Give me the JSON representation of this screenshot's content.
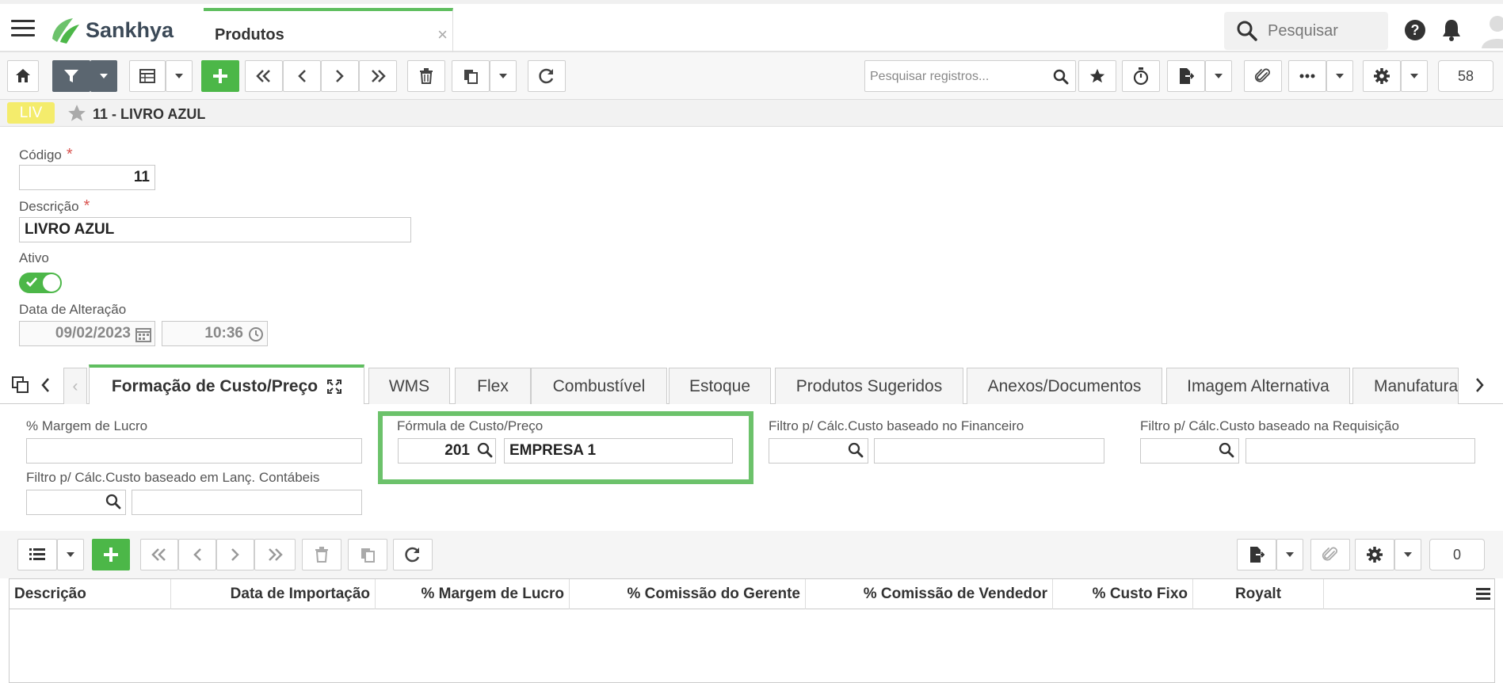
{
  "app": {
    "brand": "Sankhya",
    "tab_title": "Produtos",
    "search_placeholder": "Pesquisar"
  },
  "toolbar": {
    "search_placeholder": "Pesquisar registros...",
    "record_count": "58"
  },
  "record": {
    "badge": "LIV",
    "title": "11 - LIVRO AZUL"
  },
  "form": {
    "codigo_label": "Código",
    "codigo_value": "11",
    "descricao_label": "Descrição",
    "descricao_value": "LIVRO AZUL",
    "ativo_label": "Ativo",
    "ativo_value": true,
    "data_alteracao_label": "Data de Alteração",
    "data_value": "09/02/2023",
    "hora_value": "10:36",
    "required_mark": "*"
  },
  "tabs": [
    {
      "label": "Formação de Custo/Preço",
      "active": true
    },
    {
      "label": "WMS"
    },
    {
      "label": "Flex"
    },
    {
      "label": "Combustível"
    },
    {
      "label": "Estoque"
    },
    {
      "label": "Produtos Sugeridos"
    },
    {
      "label": "Anexos/Documentos"
    },
    {
      "label": "Imagem Alternativa"
    },
    {
      "label": "Manufatura"
    }
  ],
  "custo": {
    "margem_label": "% Margem de Lucro",
    "margem_value": "",
    "formula_label": "Fórmula de Custo/Preço",
    "formula_code": "201",
    "formula_desc": "EMPRESA 1",
    "filtro_financeiro_label": "Filtro p/ Cálc.Custo baseado no Financeiro",
    "filtro_requisicao_label": "Filtro p/ Cálc.Custo baseado na Requisição",
    "filtro_contabeis_label": "Filtro p/ Cálc.Custo baseado em Lanç. Contábeis"
  },
  "grid": {
    "count": "0",
    "columns": [
      "Descrição",
      "Data de Importação",
      "% Margem de Lucro",
      "% Comissão do Gerente",
      "% Comissão de Vendedor",
      "% Custo Fixo",
      "Royalt"
    ]
  },
  "colors": {
    "accent_green": "#4cb748",
    "highlight_border": "#6cc26b",
    "badge_yellow": "#f4ec6c",
    "dark_button": "#5b6670"
  }
}
